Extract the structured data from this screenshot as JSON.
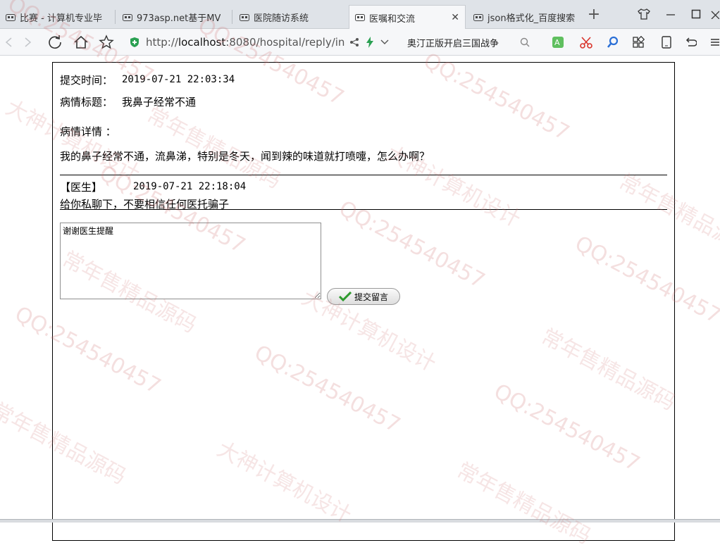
{
  "browser": {
    "tabs": [
      {
        "title": "比赛 - 计算机专业毕"
      },
      {
        "title": "973asp.net基于MV"
      },
      {
        "title": "医院随访系统"
      },
      {
        "title": "医嘱和交流",
        "active": true
      },
      {
        "title": "json格式化_百度搜索"
      }
    ],
    "address": {
      "prefix": "http://",
      "host": "localhost",
      "rest": ":8080/hospital/reply/in"
    },
    "search_text": "奥汀正版开启三国战争",
    "accent_color": "#2aa052"
  },
  "post": {
    "submit_time_label": "提交时间：",
    "submit_time": "2019-07-21 22:03:34",
    "title_label": "病情标题：",
    "title": "我鼻子经常不通",
    "detail_label": "病情详情 ：",
    "detail": "我的鼻子经常不通，流鼻涕，特别是冬天，闻到辣的味道就打喷嚏，怎么办啊？"
  },
  "reply": {
    "role": "【医生】",
    "time": "2019-07-21 22:18:04",
    "content": "给你私聊下，不要相信任何医托骗子"
  },
  "form": {
    "message": "谢谢医生提醒",
    "submit_label": "提交留言"
  },
  "watermark": {
    "qq": "QQ:254540457",
    "cn1": "常年售精品源码",
    "cn2": "大神计算机设计"
  }
}
